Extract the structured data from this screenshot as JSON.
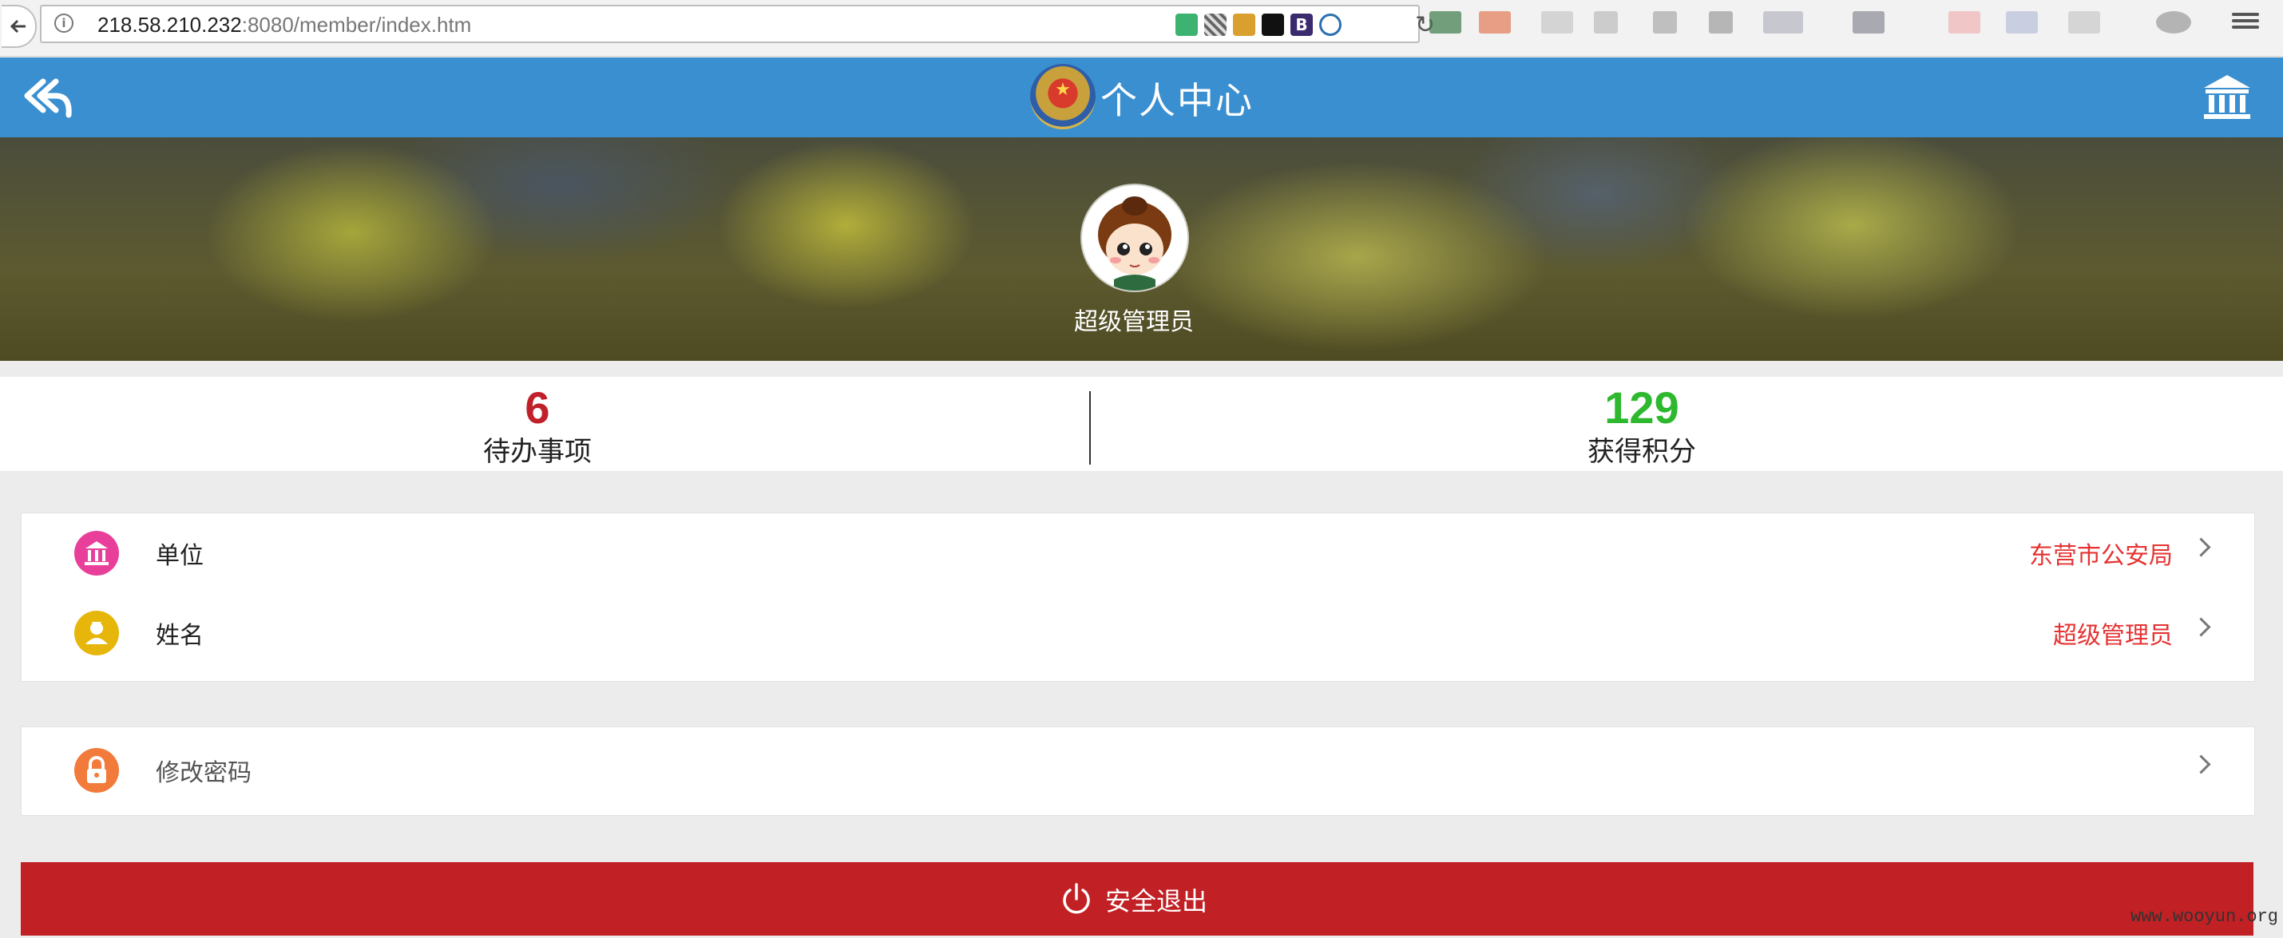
{
  "browser": {
    "url_host": "218.58.210.232",
    "url_rest": ":8080/member/index.htm"
  },
  "header": {
    "title": "个人中心",
    "back_icon": "reply-arrow-icon",
    "right_icon": "bank-building-icon"
  },
  "profile": {
    "name": "超级管理员"
  },
  "stats": [
    {
      "value": "6",
      "label": "待办事项",
      "color": "#c0202a"
    },
    {
      "value": "129",
      "label": "获得积分",
      "color": "#2db82d"
    }
  ],
  "info_rows": [
    {
      "label": "单位",
      "value": "东营市公安局",
      "icon": "bank-icon",
      "icon_color": "#e8409a"
    },
    {
      "label": "姓名",
      "value": "超级管理员",
      "icon": "user-icon",
      "icon_color": "#e6b70a"
    }
  ],
  "password_row": {
    "label": "修改密码",
    "icon": "lock-icon",
    "icon_color": "#f27a3a"
  },
  "logout": {
    "label": "安全退出",
    "icon": "power-icon",
    "color": "#c12024"
  },
  "watermark": "www.wooyun.org",
  "colors": {
    "header_blue": "#3a8fd0",
    "value_red": "#e53333"
  }
}
